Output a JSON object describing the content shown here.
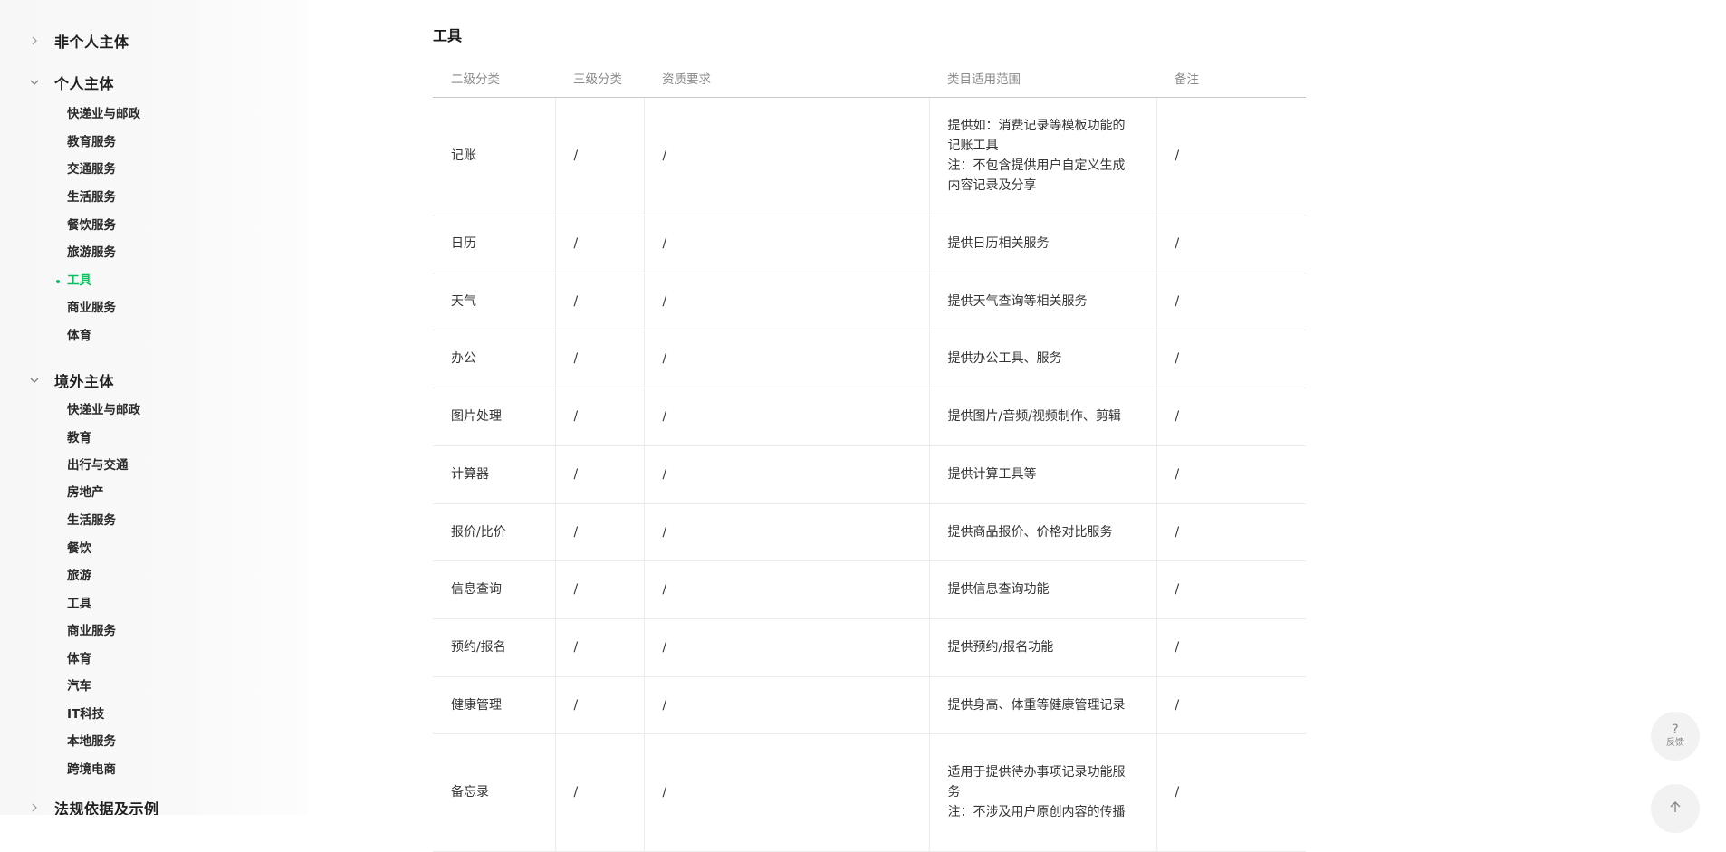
{
  "sidebar": {
    "groups": [
      {
        "title": "非个人主体",
        "expanded": false,
        "items": []
      },
      {
        "title": "个人主体",
        "expanded": true,
        "items": [
          "快递业与邮政",
          "教育服务",
          "交通服务",
          "生活服务",
          "餐饮服务",
          "旅游服务",
          "工具",
          "商业服务",
          "体育"
        ],
        "active_index": 6
      },
      {
        "title": "境外主体",
        "expanded": true,
        "items": [
          "快递业与邮政",
          "教育",
          "出行与交通",
          "房地产",
          "生活服务",
          "餐饮",
          "旅游",
          "工具",
          "商业服务",
          "体育",
          "汽车",
          "IT科技",
          "本地服务",
          "跨境电商"
        ]
      },
      {
        "title": "法规依据及示例",
        "expanded": false,
        "items": []
      }
    ]
  },
  "main": {
    "section_title": "工具",
    "columns": [
      "二级分类",
      "三级分类",
      "资质要求",
      "类目适用范围",
      "备注"
    ],
    "rows": [
      {
        "c1": "记账",
        "c2": "/",
        "c3": "/",
        "c4": [
          "提供如：消费记录等模板功能的",
          "记账工具",
          "注：不包含提供用户自定义生成",
          "内容记录及分享"
        ],
        "c5": "/"
      },
      {
        "c1": "日历",
        "c2": "/",
        "c3": "/",
        "c4": [
          "提供日历相关服务"
        ],
        "c5": "/"
      },
      {
        "c1": "天气",
        "c2": "/",
        "c3": "/",
        "c4": [
          "提供天气查询等相关服务"
        ],
        "c5": "/"
      },
      {
        "c1": "办公",
        "c2": "/",
        "c3": "/",
        "c4": [
          "提供办公工具、服务"
        ],
        "c5": "/"
      },
      {
        "c1": "图片处理",
        "c2": "/",
        "c3": "/",
        "c4": [
          "提供图片/音频/视频制作、剪辑"
        ],
        "c5": "/"
      },
      {
        "c1": "计算器",
        "c2": "/",
        "c3": "/",
        "c4": [
          "提供计算工具等"
        ],
        "c5": "/"
      },
      {
        "c1": "报价/比价",
        "c2": "/",
        "c3": "/",
        "c4": [
          "提供商品报价、价格对比服务"
        ],
        "c5": "/"
      },
      {
        "c1": "信息查询",
        "c2": "/",
        "c3": "/",
        "c4": [
          "提供信息查询功能"
        ],
        "c5": "/"
      },
      {
        "c1": "预约/报名",
        "c2": "/",
        "c3": "/",
        "c4": [
          "提供预约/报名功能"
        ],
        "c5": "/"
      },
      {
        "c1": "健康管理",
        "c2": "/",
        "c3": "/",
        "c4": [
          "提供身高、体重等健康管理记录"
        ],
        "c5": "/"
      },
      {
        "c1": "备忘录",
        "c2": "/",
        "c3": "/",
        "c4": [
          "适用于提供待办事项记录功能服",
          "务",
          "注：不涉及用户原创内容的传播"
        ],
        "c5": "/"
      }
    ]
  },
  "float": {
    "feedback_symbol": "?",
    "feedback_label": "反馈",
    "top_icon": "arrow-up-icon"
  },
  "colors": {
    "accent": "#07c160"
  }
}
